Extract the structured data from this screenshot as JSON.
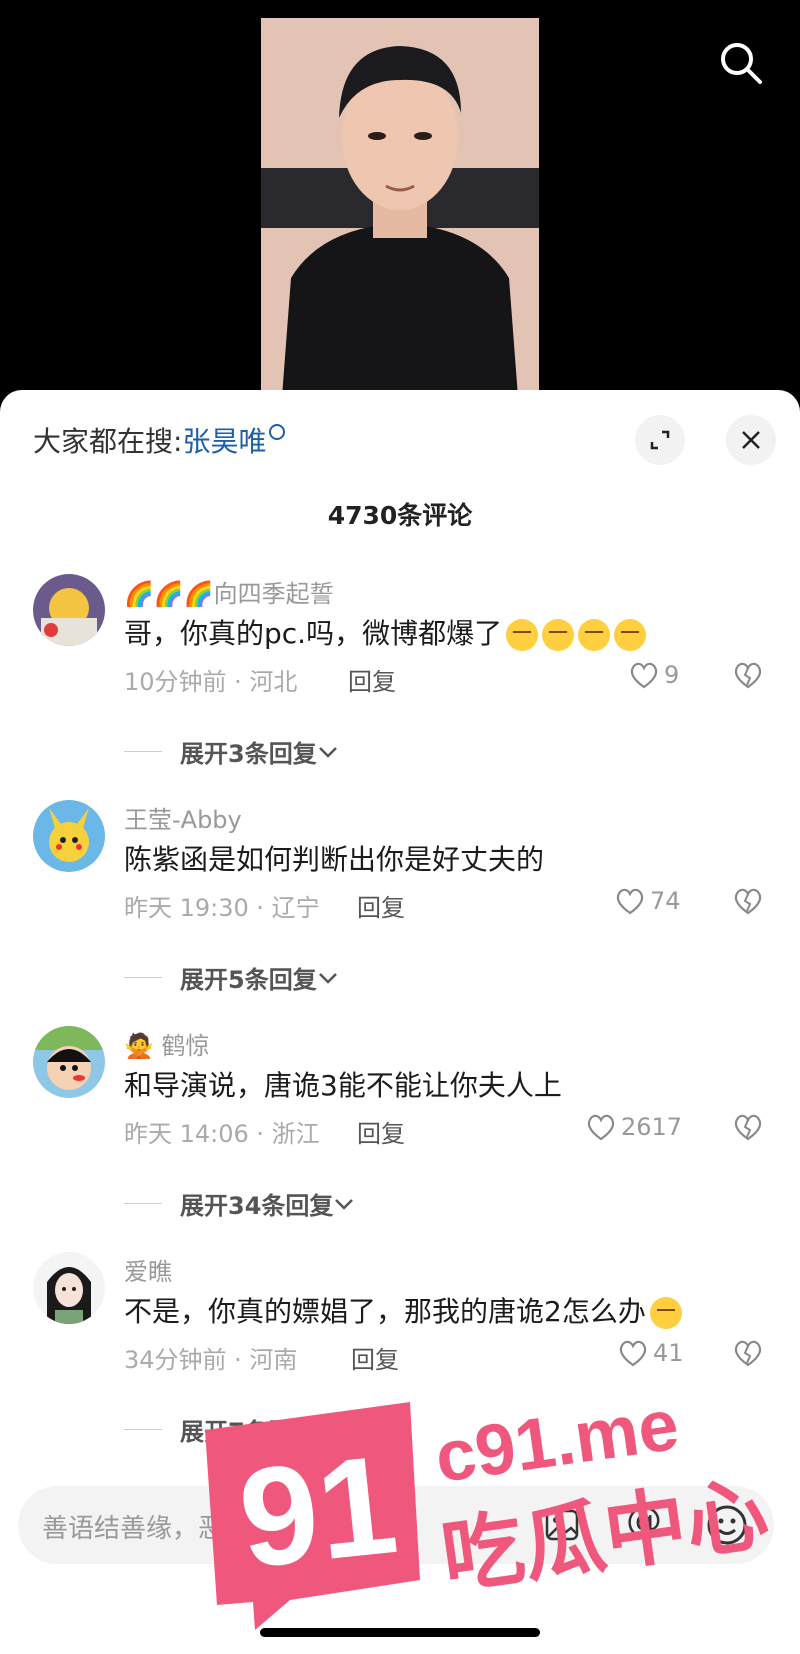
{
  "header": {
    "search_icon": "search-icon"
  },
  "panel": {
    "hot_search_prefix": "大家都在搜:",
    "hot_search_keyword": "张昊唯",
    "expand_icon": "expand-icon",
    "close_icon": "close-icon",
    "comment_count": "4730条评论"
  },
  "comments": [
    {
      "username": "🌈🌈🌈向四季起誓",
      "text": "哥，你真的pc.吗，微博都爆了",
      "emoji_count": 4,
      "time_location": "10分钟前 · 河北",
      "reply_label": "回复",
      "likes": "9",
      "expand_label": "展开3条回复"
    },
    {
      "username": "王莹-Abby",
      "text": "陈紫函是如何判断出你是好丈夫的",
      "time_location": "昨天 19:30 · 辽宁",
      "reply_label": "回复",
      "likes": "74",
      "expand_label": "展开5条回复"
    },
    {
      "username": "🙅 鹤惊",
      "text": "和导演说，唐诡3能不能让你夫人上",
      "time_location": "昨天 14:06 · 浙江",
      "reply_label": "回复",
      "likes": "2617",
      "expand_label": "展开34条回复"
    },
    {
      "username": "爱瞧",
      "text": "不是，你真的嫖娼了，那我的唐诡2怎么办",
      "time_location": "34分钟前 · 河南",
      "reply_label": "回复",
      "likes": "41",
      "expand_label": "展开7条回复"
    }
  ],
  "input": {
    "placeholder": "善语结善缘，恶言伤人心",
    "image_icon": "image-icon",
    "at_label": "@",
    "emoji_icon": "emoji-icon"
  },
  "watermark": {
    "number": "91",
    "domain": "c91.me",
    "caption": "吃瓜中心"
  },
  "colors": {
    "link": "#1d5fa8",
    "watermark": "#f0577c"
  }
}
